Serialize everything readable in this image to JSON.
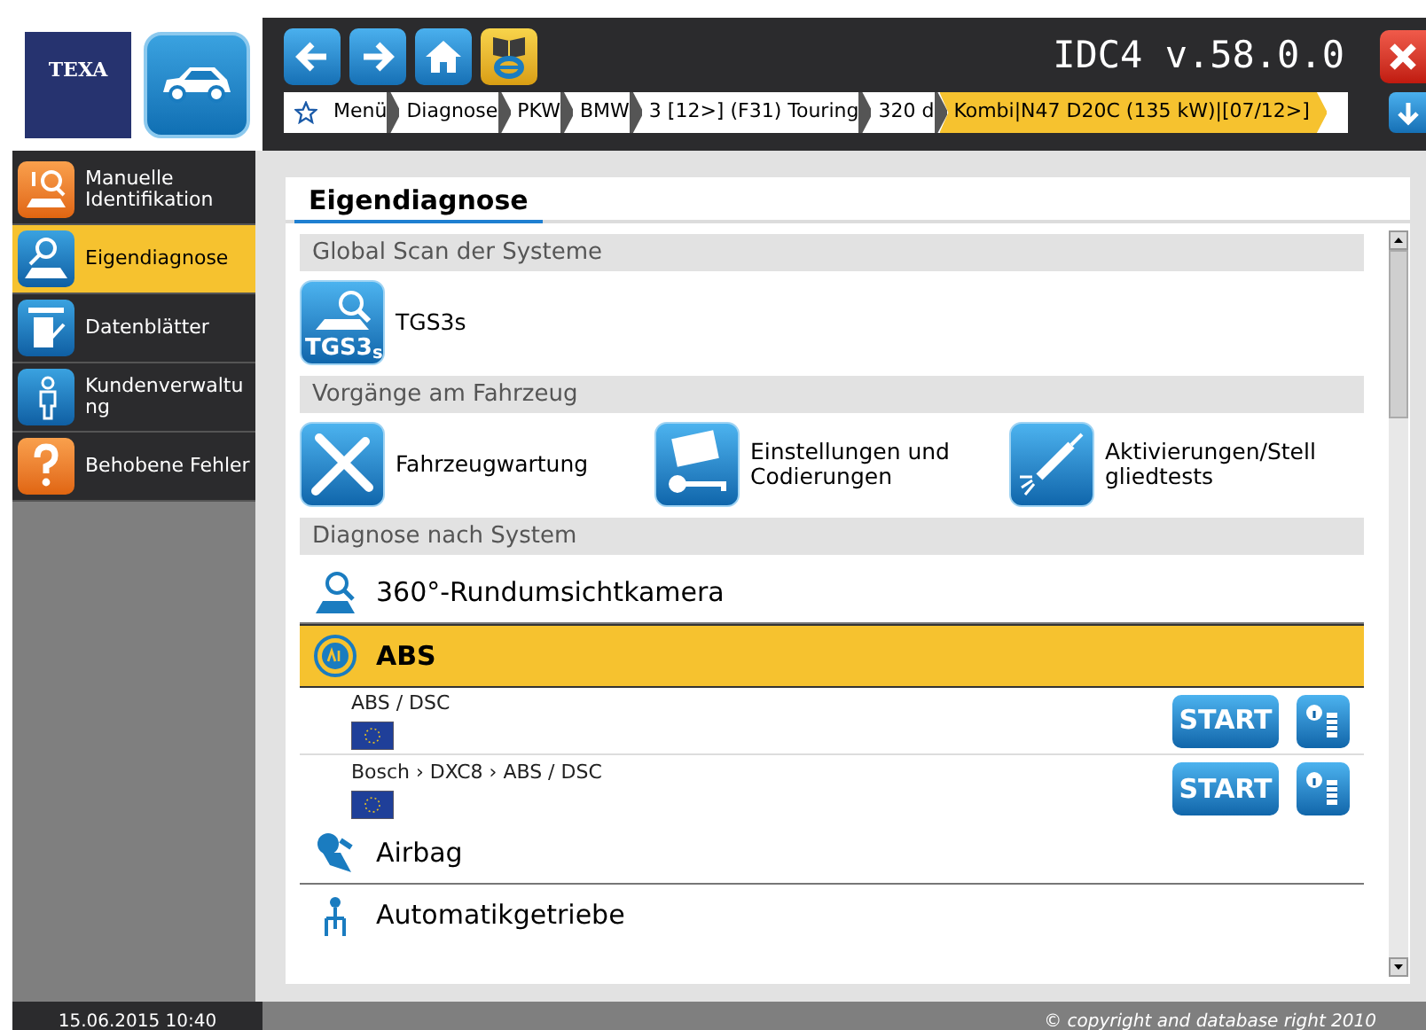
{
  "header": {
    "logo": "TEXA",
    "title": "IDC4 v.58.0.0",
    "breadcrumb": [
      {
        "label": "Menü",
        "selected": false
      },
      {
        "label": "Diagnose",
        "selected": false
      },
      {
        "label": "PKW",
        "selected": false
      },
      {
        "label": "BMW",
        "selected": false
      },
      {
        "label": "3 [12>] (F31) Touring",
        "selected": false
      },
      {
        "label": "320 d",
        "selected": false
      },
      {
        "label": "Kombi|N47 D20C (135 kW)|[07/12>]",
        "selected": true
      }
    ]
  },
  "sidebar": {
    "items": [
      {
        "label": "Manuelle Identifikation",
        "selected": false
      },
      {
        "label": "Eigendiagnose",
        "selected": true
      },
      {
        "label": "Datenblätter",
        "selected": false
      },
      {
        "label": "Kundenverwaltu ng",
        "selected": false
      },
      {
        "label": "Behobene Fehler",
        "selected": false
      }
    ]
  },
  "page": {
    "tab": "Eigendiagnose",
    "sections": [
      {
        "title": "Global Scan der Systeme",
        "items": [
          {
            "label": "TGS3s",
            "badge": "TGS3$_{s}$"
          }
        ]
      },
      {
        "title": "Vorgänge am Fahrzeug",
        "items": [
          {
            "label": "Fahrzeugwartung"
          },
          {
            "label": "Einstellungen und Codierungen"
          },
          {
            "label": "Aktivierungen/Stell gliedtests"
          }
        ]
      },
      {
        "title": "Diagnose nach System"
      }
    ],
    "systems": [
      {
        "label": "360°-Rundumsichtkamera",
        "expanded": false
      },
      {
        "label": "ABS",
        "expanded": true,
        "variants": [
          {
            "path": "ABS / DSC",
            "button": "START"
          },
          {
            "path": "Bosch › DXC8 › ABS / DSC",
            "button": "START"
          }
        ]
      },
      {
        "label": "Airbag",
        "expanded": false
      },
      {
        "label": "Automatikgetriebe",
        "expanded": false
      }
    ]
  },
  "status_bar": {
    "datetime": "15.06.2015 10:40",
    "copyright": "© copyright and database right 2010"
  }
}
